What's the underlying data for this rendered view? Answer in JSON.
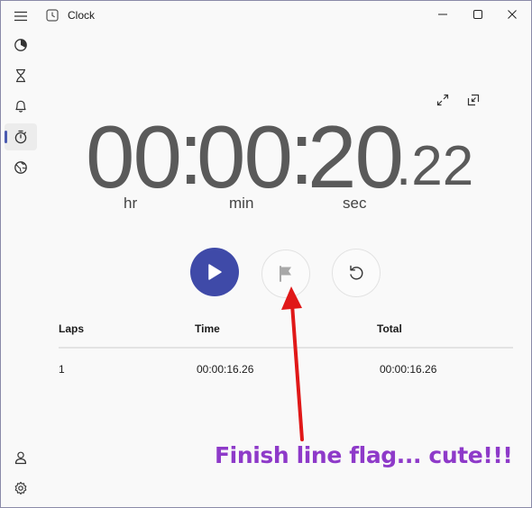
{
  "app": {
    "title": "Clock"
  },
  "sidebar": {
    "items": [
      {
        "name": "focus-sessions",
        "icon": "focus-icon"
      },
      {
        "name": "timer",
        "icon": "hourglass-icon"
      },
      {
        "name": "alarm",
        "icon": "bell-icon"
      },
      {
        "name": "stopwatch",
        "icon": "stopwatch-icon",
        "active": true
      },
      {
        "name": "world-clock",
        "icon": "globe-icon"
      }
    ],
    "bottom": [
      {
        "name": "account",
        "icon": "person-icon"
      },
      {
        "name": "settings",
        "icon": "gear-icon"
      }
    ]
  },
  "stopwatch": {
    "hours": "00",
    "minutes": "00",
    "seconds": "20",
    "hundredths": ".22",
    "sep1": ":",
    "sep2": ":",
    "unit_hr": "hr",
    "unit_min": "min",
    "unit_sec": "sec"
  },
  "laps": {
    "headers": {
      "laps": "Laps",
      "time": "Time",
      "total": "Total"
    },
    "rows": [
      {
        "lap": "1",
        "time": "00:00:16.26",
        "total": "00:00:16.26"
      }
    ]
  },
  "annotation": {
    "text": "Finish line flag... cute!!!"
  },
  "colors": {
    "accent": "#3f4aa8",
    "annotation_text": "#8e3ac9",
    "arrow": "#e01818"
  }
}
